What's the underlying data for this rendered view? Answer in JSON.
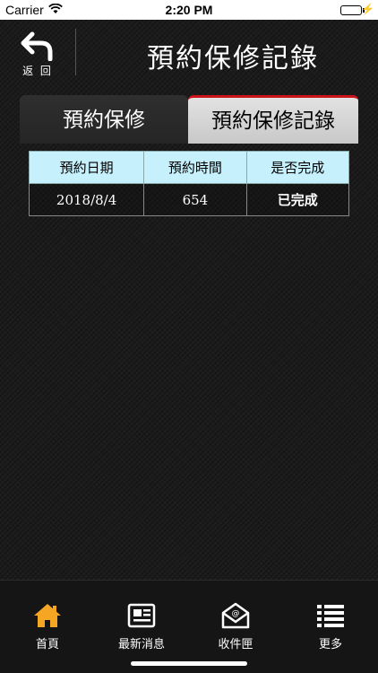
{
  "status_bar": {
    "carrier": "Carrier",
    "time": "2:20 PM"
  },
  "header": {
    "back_label": "返 回",
    "title": "預約保修記錄"
  },
  "tabs": [
    {
      "label": "預約保修",
      "active": false
    },
    {
      "label": "預約保修記錄",
      "active": true
    }
  ],
  "table": {
    "headers": [
      "預約日期",
      "預約時間",
      "是否完成"
    ],
    "rows": [
      [
        "2018/8/4",
        "654",
        "已完成"
      ]
    ]
  },
  "tabbar": {
    "items": [
      {
        "label": "首頁",
        "icon": "home-icon"
      },
      {
        "label": "最新消息",
        "icon": "newspaper-icon"
      },
      {
        "label": "收件匣",
        "icon": "mail-icon"
      },
      {
        "label": "更多",
        "icon": "list-icon"
      }
    ]
  },
  "colors": {
    "accent": "#c9141a",
    "header_cell": "#c6f0fb",
    "home_icon": "#f5a623"
  }
}
